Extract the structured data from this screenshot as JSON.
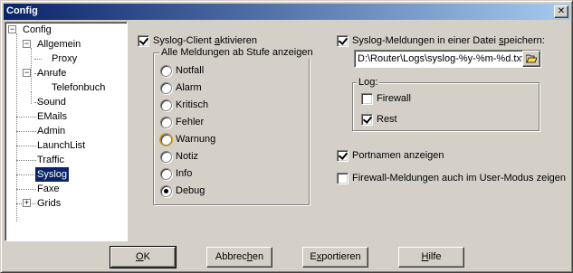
{
  "window": {
    "title": "Config",
    "close_glyph": "✕"
  },
  "tree": {
    "items": [
      {
        "label": "Config",
        "expander": "−"
      },
      {
        "label": "Allgemein",
        "expander": "−"
      },
      {
        "label": "Proxy"
      },
      {
        "label": "Anrufe",
        "expander": "−"
      },
      {
        "label": "Telefonbuch"
      },
      {
        "label": "Sound"
      },
      {
        "label": "EMails"
      },
      {
        "label": "Admin"
      },
      {
        "label": "LaunchList"
      },
      {
        "label": "Traffic"
      },
      {
        "label": "Syslog",
        "selected": true
      },
      {
        "label": "Faxe"
      },
      {
        "label": "Grids",
        "expander": "+"
      }
    ]
  },
  "syslog_client": {
    "pre": "Syslog-Client ",
    "accel": "a",
    "post": "ktivieren",
    "checked": true
  },
  "levels_group": {
    "title": "Alle Meldungen ab Stufe anzeigen",
    "options": [
      "Notfall",
      "Alarm",
      "Kritisch",
      "Fehler",
      "Warnung",
      "Notiz",
      "Info",
      "Debug"
    ],
    "selected": "Debug"
  },
  "file_logging": {
    "pre": "Syslog-Meldungen in einer Datei ",
    "accel": "s",
    "post": "peichern:",
    "checked": true
  },
  "file_path": "D:\\Router\\Logs\\syslog-%y-%m-%d.txt",
  "log_group": {
    "title": "Log:",
    "firewall": {
      "label": "Firewall",
      "checked": false
    },
    "rest": {
      "label": "Rest",
      "checked": true
    }
  },
  "port_names": {
    "label": "Portnamen anzeigen",
    "checked": true
  },
  "firewall_user_mode": {
    "label": "Firewall-Meldungen auch im User-Modus zeigen",
    "checked": false
  },
  "buttons": {
    "ok": {
      "accel": "O",
      "rest": "K"
    },
    "cancel": {
      "pre": "Abbrec",
      "accel": "h",
      "post": "en"
    },
    "export": {
      "pre": "E",
      "accel": "x",
      "post": "portieren"
    },
    "help": {
      "accel": "H",
      "rest": "ilfe"
    }
  },
  "colors": {
    "selection": "#0a246a",
    "titlebar_start": "#0a246a",
    "titlebar_end": "#a6caf0",
    "face": "#d4d0c8"
  }
}
